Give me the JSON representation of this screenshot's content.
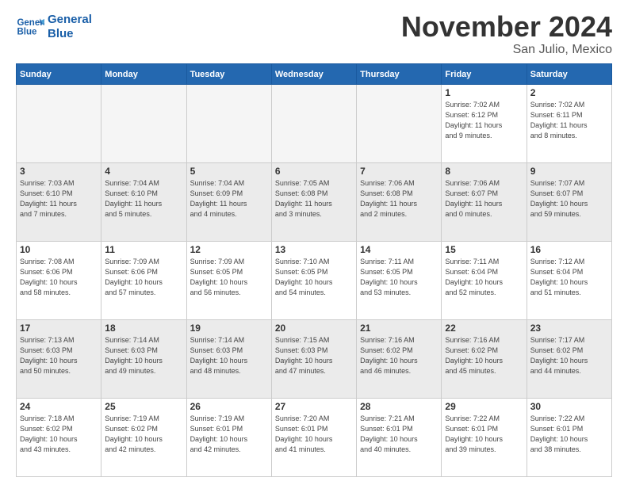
{
  "header": {
    "logo_text_general": "General",
    "logo_text_blue": "Blue",
    "month_title": "November 2024",
    "location": "San Julio, Mexico"
  },
  "weekdays": [
    "Sunday",
    "Monday",
    "Tuesday",
    "Wednesday",
    "Thursday",
    "Friday",
    "Saturday"
  ],
  "weeks": [
    [
      {
        "day": "",
        "info": ""
      },
      {
        "day": "",
        "info": ""
      },
      {
        "day": "",
        "info": ""
      },
      {
        "day": "",
        "info": ""
      },
      {
        "day": "",
        "info": ""
      },
      {
        "day": "1",
        "info": "Sunrise: 7:02 AM\nSunset: 6:12 PM\nDaylight: 11 hours\nand 9 minutes."
      },
      {
        "day": "2",
        "info": "Sunrise: 7:02 AM\nSunset: 6:11 PM\nDaylight: 11 hours\nand 8 minutes."
      }
    ],
    [
      {
        "day": "3",
        "info": "Sunrise: 7:03 AM\nSunset: 6:10 PM\nDaylight: 11 hours\nand 7 minutes."
      },
      {
        "day": "4",
        "info": "Sunrise: 7:04 AM\nSunset: 6:10 PM\nDaylight: 11 hours\nand 5 minutes."
      },
      {
        "day": "5",
        "info": "Sunrise: 7:04 AM\nSunset: 6:09 PM\nDaylight: 11 hours\nand 4 minutes."
      },
      {
        "day": "6",
        "info": "Sunrise: 7:05 AM\nSunset: 6:08 PM\nDaylight: 11 hours\nand 3 minutes."
      },
      {
        "day": "7",
        "info": "Sunrise: 7:06 AM\nSunset: 6:08 PM\nDaylight: 11 hours\nand 2 minutes."
      },
      {
        "day": "8",
        "info": "Sunrise: 7:06 AM\nSunset: 6:07 PM\nDaylight: 11 hours\nand 0 minutes."
      },
      {
        "day": "9",
        "info": "Sunrise: 7:07 AM\nSunset: 6:07 PM\nDaylight: 10 hours\nand 59 minutes."
      }
    ],
    [
      {
        "day": "10",
        "info": "Sunrise: 7:08 AM\nSunset: 6:06 PM\nDaylight: 10 hours\nand 58 minutes."
      },
      {
        "day": "11",
        "info": "Sunrise: 7:09 AM\nSunset: 6:06 PM\nDaylight: 10 hours\nand 57 minutes."
      },
      {
        "day": "12",
        "info": "Sunrise: 7:09 AM\nSunset: 6:05 PM\nDaylight: 10 hours\nand 56 minutes."
      },
      {
        "day": "13",
        "info": "Sunrise: 7:10 AM\nSunset: 6:05 PM\nDaylight: 10 hours\nand 54 minutes."
      },
      {
        "day": "14",
        "info": "Sunrise: 7:11 AM\nSunset: 6:05 PM\nDaylight: 10 hours\nand 53 minutes."
      },
      {
        "day": "15",
        "info": "Sunrise: 7:11 AM\nSunset: 6:04 PM\nDaylight: 10 hours\nand 52 minutes."
      },
      {
        "day": "16",
        "info": "Sunrise: 7:12 AM\nSunset: 6:04 PM\nDaylight: 10 hours\nand 51 minutes."
      }
    ],
    [
      {
        "day": "17",
        "info": "Sunrise: 7:13 AM\nSunset: 6:03 PM\nDaylight: 10 hours\nand 50 minutes."
      },
      {
        "day": "18",
        "info": "Sunrise: 7:14 AM\nSunset: 6:03 PM\nDaylight: 10 hours\nand 49 minutes."
      },
      {
        "day": "19",
        "info": "Sunrise: 7:14 AM\nSunset: 6:03 PM\nDaylight: 10 hours\nand 48 minutes."
      },
      {
        "day": "20",
        "info": "Sunrise: 7:15 AM\nSunset: 6:03 PM\nDaylight: 10 hours\nand 47 minutes."
      },
      {
        "day": "21",
        "info": "Sunrise: 7:16 AM\nSunset: 6:02 PM\nDaylight: 10 hours\nand 46 minutes."
      },
      {
        "day": "22",
        "info": "Sunrise: 7:16 AM\nSunset: 6:02 PM\nDaylight: 10 hours\nand 45 minutes."
      },
      {
        "day": "23",
        "info": "Sunrise: 7:17 AM\nSunset: 6:02 PM\nDaylight: 10 hours\nand 44 minutes."
      }
    ],
    [
      {
        "day": "24",
        "info": "Sunrise: 7:18 AM\nSunset: 6:02 PM\nDaylight: 10 hours\nand 43 minutes."
      },
      {
        "day": "25",
        "info": "Sunrise: 7:19 AM\nSunset: 6:02 PM\nDaylight: 10 hours\nand 42 minutes."
      },
      {
        "day": "26",
        "info": "Sunrise: 7:19 AM\nSunset: 6:01 PM\nDaylight: 10 hours\nand 42 minutes."
      },
      {
        "day": "27",
        "info": "Sunrise: 7:20 AM\nSunset: 6:01 PM\nDaylight: 10 hours\nand 41 minutes."
      },
      {
        "day": "28",
        "info": "Sunrise: 7:21 AM\nSunset: 6:01 PM\nDaylight: 10 hours\nand 40 minutes."
      },
      {
        "day": "29",
        "info": "Sunrise: 7:22 AM\nSunset: 6:01 PM\nDaylight: 10 hours\nand 39 minutes."
      },
      {
        "day": "30",
        "info": "Sunrise: 7:22 AM\nSunset: 6:01 PM\nDaylight: 10 hours\nand 38 minutes."
      }
    ]
  ]
}
